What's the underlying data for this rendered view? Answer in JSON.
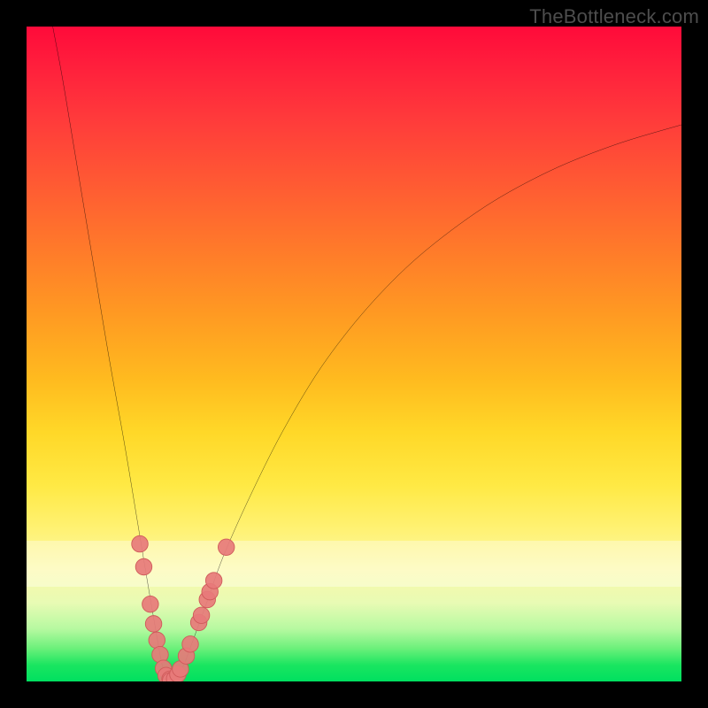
{
  "watermark": "TheBottleneck.com",
  "colors": {
    "frame": "#000000",
    "curve": "#000000",
    "marker_fill": "#e77a7a",
    "marker_stroke": "#cf5a5a",
    "gradient_top": "#ff0a3a",
    "gradient_bottom": "#00e060"
  },
  "chart_data": {
    "type": "line",
    "title": "",
    "xlabel": "",
    "ylabel": "",
    "xlim": [
      0,
      100
    ],
    "ylim": [
      0,
      100
    ],
    "grid": false,
    "curve_points": [
      {
        "x": 4.0,
        "y": 100.0
      },
      {
        "x": 5.5,
        "y": 92.0
      },
      {
        "x": 7.5,
        "y": 80.0
      },
      {
        "x": 10.0,
        "y": 65.0
      },
      {
        "x": 12.5,
        "y": 50.0
      },
      {
        "x": 15.0,
        "y": 36.0
      },
      {
        "x": 17.0,
        "y": 24.0
      },
      {
        "x": 18.5,
        "y": 15.0
      },
      {
        "x": 19.7,
        "y": 8.0
      },
      {
        "x": 20.5,
        "y": 3.5
      },
      {
        "x": 21.0,
        "y": 1.5
      },
      {
        "x": 21.5,
        "y": 0.5
      },
      {
        "x": 22.0,
        "y": 0.0
      },
      {
        "x": 22.5,
        "y": 0.1
      },
      {
        "x": 23.0,
        "y": 0.7
      },
      {
        "x": 24.0,
        "y": 2.5
      },
      {
        "x": 25.5,
        "y": 6.5
      },
      {
        "x": 27.5,
        "y": 12.0
      },
      {
        "x": 30.0,
        "y": 19.0
      },
      {
        "x": 34.0,
        "y": 28.0
      },
      {
        "x": 39.0,
        "y": 38.0
      },
      {
        "x": 45.0,
        "y": 48.0
      },
      {
        "x": 52.0,
        "y": 57.0
      },
      {
        "x": 60.0,
        "y": 65.0
      },
      {
        "x": 70.0,
        "y": 72.5
      },
      {
        "x": 80.0,
        "y": 78.0
      },
      {
        "x": 90.0,
        "y": 82.0
      },
      {
        "x": 100.0,
        "y": 85.0
      }
    ],
    "markers": {
      "left": [
        {
          "x": 17.3,
          "y": 21.0
        },
        {
          "x": 17.9,
          "y": 17.5
        },
        {
          "x": 18.9,
          "y": 11.8
        },
        {
          "x": 19.4,
          "y": 8.8
        },
        {
          "x": 19.9,
          "y": 6.3
        },
        {
          "x": 20.4,
          "y": 4.1
        }
      ],
      "bottom": [
        {
          "x": 20.9,
          "y": 2.0
        },
        {
          "x": 21.3,
          "y": 0.9
        },
        {
          "x": 21.9,
          "y": 0.35
        },
        {
          "x": 22.0,
          "y": 0.15
        },
        {
          "x": 22.6,
          "y": 0.4
        },
        {
          "x": 23.1,
          "y": 1.1
        }
      ],
      "right": [
        {
          "x": 23.5,
          "y": 1.9
        },
        {
          "x": 24.4,
          "y": 3.9
        },
        {
          "x": 25.0,
          "y": 5.7
        },
        {
          "x": 26.3,
          "y": 9.0
        },
        {
          "x": 26.7,
          "y": 10.1
        },
        {
          "x": 27.6,
          "y": 12.5
        },
        {
          "x": 28.0,
          "y": 13.7
        },
        {
          "x": 28.6,
          "y": 15.4
        },
        {
          "x": 30.5,
          "y": 20.5
        }
      ]
    }
  }
}
